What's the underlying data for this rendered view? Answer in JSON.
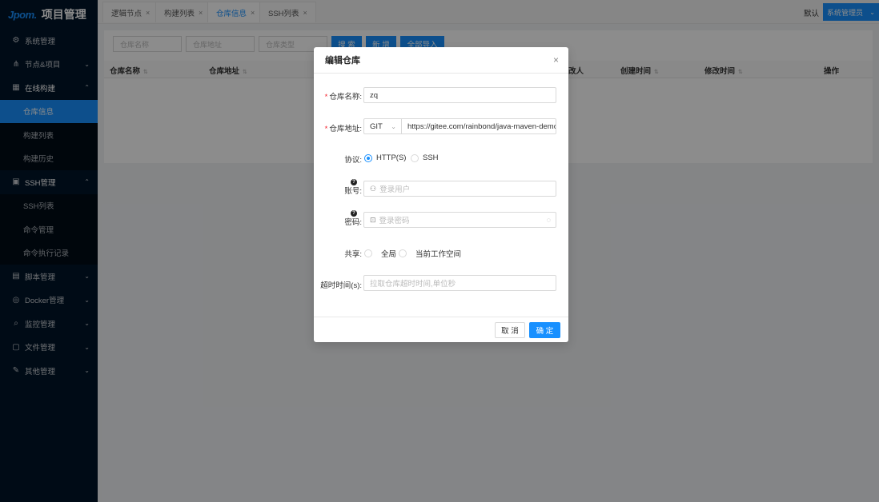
{
  "app": {
    "logo_mark": "Jpom.",
    "title": "项目管理"
  },
  "sidebar": {
    "items": [
      {
        "label": "系统管理",
        "icon": "gear-icon",
        "glyph": "⚙",
        "arrow": ""
      },
      {
        "label": "节点&项目",
        "icon": "cluster-icon",
        "glyph": "⋔",
        "arrow": "⌄"
      },
      {
        "label": "在线构建",
        "icon": "build-icon",
        "glyph": "▦",
        "arrow": "⌃"
      },
      {
        "label": "SSH管理",
        "icon": "terminal-icon",
        "glyph": "▣",
        "arrow": "⌃"
      },
      {
        "label": "脚本管理",
        "icon": "file-code-icon",
        "glyph": "▤",
        "arrow": "⌄"
      },
      {
        "label": "Docker管理",
        "icon": "docker-icon",
        "glyph": "◎",
        "arrow": "⌄"
      },
      {
        "label": "监控管理",
        "icon": "monitor-icon",
        "glyph": "⌕",
        "arrow": "⌄"
      },
      {
        "label": "文件管理",
        "icon": "file-icon",
        "glyph": "▢",
        "arrow": "⌄"
      },
      {
        "label": "其他管理",
        "icon": "tool-icon",
        "glyph": "✎",
        "arrow": "⌄"
      }
    ],
    "build_sub": [
      "仓库信息",
      "构建列表",
      "构建历史"
    ],
    "ssh_sub": [
      "SSH列表",
      "命令管理",
      "命令执行记录"
    ]
  },
  "tabs": [
    {
      "label": "逻辑节点",
      "close": "×"
    },
    {
      "label": "构建列表",
      "close": "×"
    },
    {
      "label": "仓库信息",
      "close": "×"
    },
    {
      "label": "SSH列表",
      "close": "×"
    }
  ],
  "header": {
    "workspace": "默认",
    "user": "系统管理员",
    "dropdown": "⌄"
  },
  "toolbar": {
    "filter_name": "仓库名称",
    "filter_addr": "仓库地址",
    "filter_type": "仓库类型",
    "search_label": "搜 索",
    "add_label": "新 增",
    "import_label": "全部导入"
  },
  "table": {
    "headers": [
      "仓库名称",
      "仓库地址",
      "改人",
      "创建时间",
      "修改时间",
      "操作"
    ],
    "sort_glyph": "⇅"
  },
  "modal": {
    "title": "编辑仓库",
    "close": "×",
    "name_label": "仓库名称:",
    "name_value": "zq",
    "addr_label": "仓库地址:",
    "repo_type": "GIT",
    "repo_url": "https://gitee.com/rainbond/java-maven-demo",
    "protocol_label": "协议:",
    "protocol_options": [
      "HTTP(S)",
      "SSH"
    ],
    "protocol_selected": "HTTP(S)",
    "account_label": "账号",
    "account_placeholder": "登录用户",
    "password_label": "密码",
    "password_placeholder": "登录密码",
    "share_label": "共享:",
    "share_options": [
      "全局",
      "当前工作空间"
    ],
    "timeout_label": "超时时间(s):",
    "timeout_placeholder": "拉取仓库超时时间,单位秒",
    "help_glyph": "?",
    "required_mark": "*",
    "colon": ":",
    "cancel_label": "取 消",
    "ok_label": "确 定"
  },
  "colors": {
    "primary": "#1890ff",
    "sidebar_bg": "#001529",
    "danger": "#f5222d"
  }
}
